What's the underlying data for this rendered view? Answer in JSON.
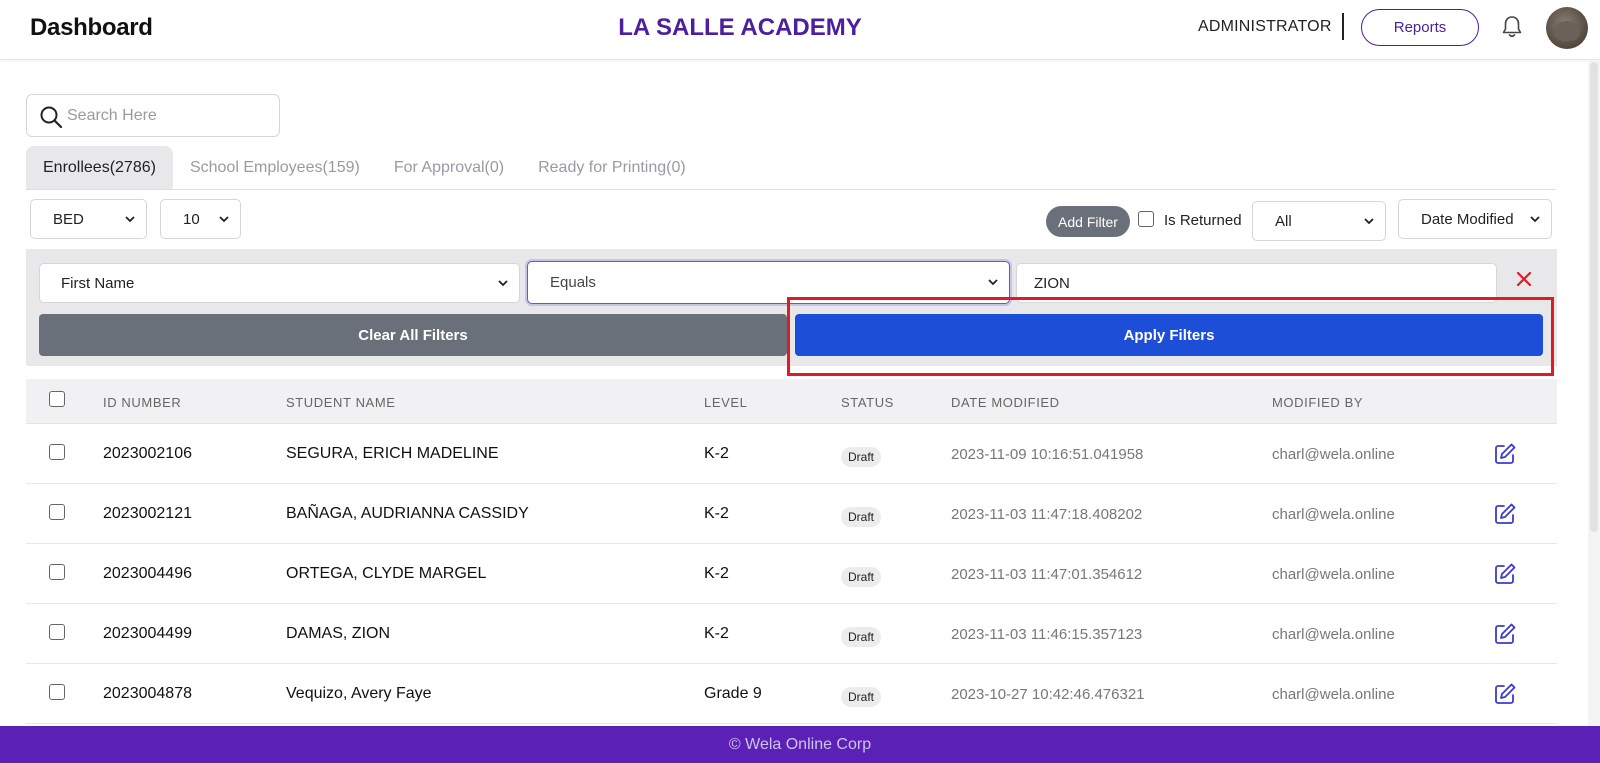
{
  "header": {
    "title": "Dashboard",
    "school_name": "LA SALLE ACADEMY",
    "role": "ADMINISTRATOR",
    "reports_label": "Reports"
  },
  "search": {
    "placeholder": "Search Here",
    "value": ""
  },
  "tabs": [
    {
      "label": "Enrollees(2786)",
      "active": true
    },
    {
      "label": "School Employees(159)",
      "active": false
    },
    {
      "label": "For Approval(0)",
      "active": false
    },
    {
      "label": "Ready for Printing(0)",
      "active": false
    }
  ],
  "controls": {
    "department": "BED",
    "page_size": "10",
    "add_filter_label": "Add Filter",
    "is_returned_label": "Is Returned",
    "status_select": "All",
    "sort_select": "Date Modified"
  },
  "filter": {
    "field": "First Name",
    "operator": "Equals",
    "value": "ZION",
    "clear_label": "Clear All Filters",
    "apply_label": "Apply Filters"
  },
  "table": {
    "headers": {
      "id": "ID NUMBER",
      "name": "STUDENT NAME",
      "level": "LEVEL",
      "status": "STATUS",
      "date": "DATE MODIFIED",
      "by": "MODIFIED BY"
    },
    "rows": [
      {
        "id": "2023002106",
        "name": "SEGURA, ERICH MADELINE",
        "level": "K-2",
        "status": "Draft",
        "date": "2023-11-09 10:16:51.041958",
        "by": "charl@wela.online"
      },
      {
        "id": "2023002121",
        "name": "BAÑAGA, AUDRIANNA CASSIDY",
        "level": "K-2",
        "status": "Draft",
        "date": "2023-11-03 11:47:18.408202",
        "by": "charl@wela.online"
      },
      {
        "id": "2023004496",
        "name": "ORTEGA, CLYDE MARGEL",
        "level": "K-2",
        "status": "Draft",
        "date": "2023-11-03 11:47:01.354612",
        "by": "charl@wela.online"
      },
      {
        "id": "2023004499",
        "name": "DAMAS, ZION",
        "level": "K-2",
        "status": "Draft",
        "date": "2023-11-03 11:46:15.357123",
        "by": "charl@wela.online"
      },
      {
        "id": "2023004878",
        "name": "Vequizo, Avery Faye",
        "level": "Grade 9",
        "status": "Draft",
        "date": "2023-10-27 10:42:46.476321",
        "by": "charl@wela.online"
      }
    ]
  },
  "footer": {
    "text": "© Wela Online Corp"
  },
  "colors": {
    "brand_purple": "#4b1fa0",
    "footer_purple": "#5b21b6",
    "apply_blue": "#1d4ed8",
    "clear_gray": "#6a707a",
    "highlight_red": "#e01b24"
  }
}
